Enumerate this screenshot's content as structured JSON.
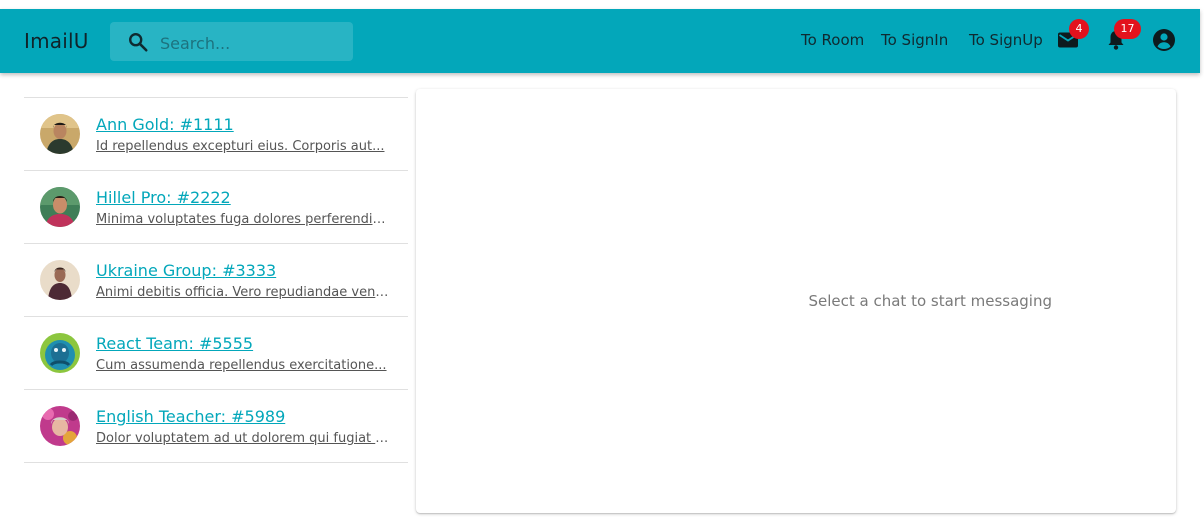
{
  "app": {
    "title": "ImailU",
    "accent": "#03a7ba"
  },
  "search": {
    "placeholder": "Search...",
    "value": "",
    "icon": "search-icon"
  },
  "nav": {
    "room_label": "To Room",
    "signin_label": "To SignIn",
    "signup_label": "To SignUp"
  },
  "indicators": {
    "mail": {
      "icon": "mail-icon",
      "count": "4"
    },
    "notifications": {
      "icon": "bell-icon",
      "count": "17"
    },
    "account": {
      "icon": "account-circle-icon"
    },
    "badge_color": "#e3121d"
  },
  "chats": [
    {
      "title": "Ann Gold: #1111",
      "preview": "Id repellendus excepturi eius. Corporis aut..."
    },
    {
      "title": "Hillel Pro: #2222",
      "preview": "Minima voluptates fuga dolores perferendis..."
    },
    {
      "title": "Ukraine Group: #3333",
      "preview": "Animi debitis officia. Vero repudiandae veni..."
    },
    {
      "title": "React Team: #5555",
      "preview": "Cum assumenda repellendus exercitatione..."
    },
    {
      "title": "English Teacher: #5989",
      "preview": "Dolor voluptatem ad ut dolorem qui fugiat s..."
    }
  ],
  "main": {
    "empty_message": "Select a chat to start messaging"
  }
}
